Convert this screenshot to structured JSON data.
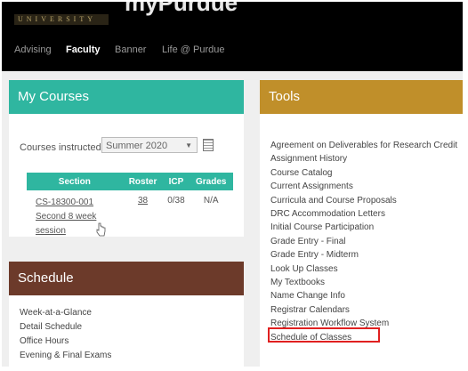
{
  "header": {
    "logo_text": "UNIVERSITY",
    "app_title": "myPurdue"
  },
  "nav": {
    "items": [
      "Advising",
      "Faculty",
      "Banner",
      "Life @ Purdue"
    ],
    "active": "Faculty"
  },
  "my_courses": {
    "title": "My Courses",
    "term_label": "Courses instructed for",
    "term_value": "Summer 2020",
    "table": {
      "headers": [
        "Section",
        "Roster",
        "ICP",
        "Grades"
      ],
      "rows": [
        {
          "section_lines": [
            "CS-18300-001",
            "Second 8 week",
            "session"
          ],
          "roster": "38",
          "icp": "0/38",
          "grades": "N/A"
        }
      ]
    },
    "accent_color": "#2fb6a0"
  },
  "schedule": {
    "title": "Schedule",
    "items": [
      "Week-at-a-Glance",
      "Detail Schedule",
      "Office Hours",
      "Evening & Final Exams"
    ],
    "accent_color": "#6c3a2a"
  },
  "tools": {
    "title": "Tools",
    "items": [
      "Agreement on Deliverables for Research Credit",
      "Assignment History",
      "Course Catalog",
      "Current Assignments",
      "Curricula and Course Proposals",
      "DRC Accommodation Letters",
      "Initial Course Participation",
      "Grade Entry - Final",
      "Grade Entry - Midterm",
      "Look Up Classes",
      "My Textbooks",
      "Name Change Info",
      "Registrar Calendars",
      "Registration Workflow System",
      "Schedule of Classes"
    ],
    "highlighted_item": "Registration Workflow System",
    "accent_color": "#c08f2a"
  }
}
